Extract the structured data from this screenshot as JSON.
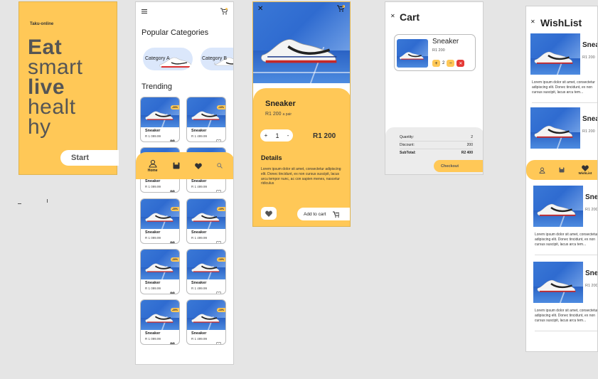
{
  "splash": {
    "brand": "Taku-online",
    "headline": [
      "Eat",
      "smart",
      "live",
      "healt",
      "hy"
    ],
    "start_label": "Start"
  },
  "home": {
    "popular_title": "Popular Categories",
    "categories": [
      "Category A",
      "Category B"
    ],
    "trending_title": "Trending",
    "product_name": "Sneaker",
    "prices": [
      "R 1 099.99",
      "R 1 499.99"
    ],
    "badges": [
      "-20%",
      "-10%"
    ],
    "nav": {
      "home_label": "Home"
    }
  },
  "detail": {
    "cart_count": "2",
    "title": "Sneaker",
    "price": "R1 200",
    "price_unit": "a pair",
    "qty_minus": "-",
    "qty_plus": "+",
    "qty_value": "1",
    "total": "R1 200",
    "details_title": "Details",
    "details_text": "Lorem ipsum dolor sit amet, consectetur adipiscing elit. Donec tincidunt, ex non cursus suscipit, lacus arcu tempor nunc, ac con sapien menes, nascetur ridiculus",
    "add_to_cart_label": "Add to cart"
  },
  "cart": {
    "title": "Cart",
    "item_name": "Sneaker",
    "item_price": "R1 200",
    "item_qty": "2",
    "summary": [
      {
        "label": "Quantity:",
        "value": "2"
      },
      {
        "label": "Discount:",
        "value": "200"
      },
      {
        "label": "SubTotal:",
        "value": "R2 400"
      }
    ],
    "checkout_label": "Checkout"
  },
  "wishlist": {
    "title": "WishList",
    "item_name": "Snea",
    "item_price": "R1 200",
    "desc": "Lorem ipsum dolor sit amet, consectetur adipiscing elit. Donec tincidunt, ex non cursus suscipit, lacus arcu tem...",
    "nav_label": "WishList"
  },
  "colors": {
    "accent": "#ffc857",
    "red": "#e53935"
  }
}
